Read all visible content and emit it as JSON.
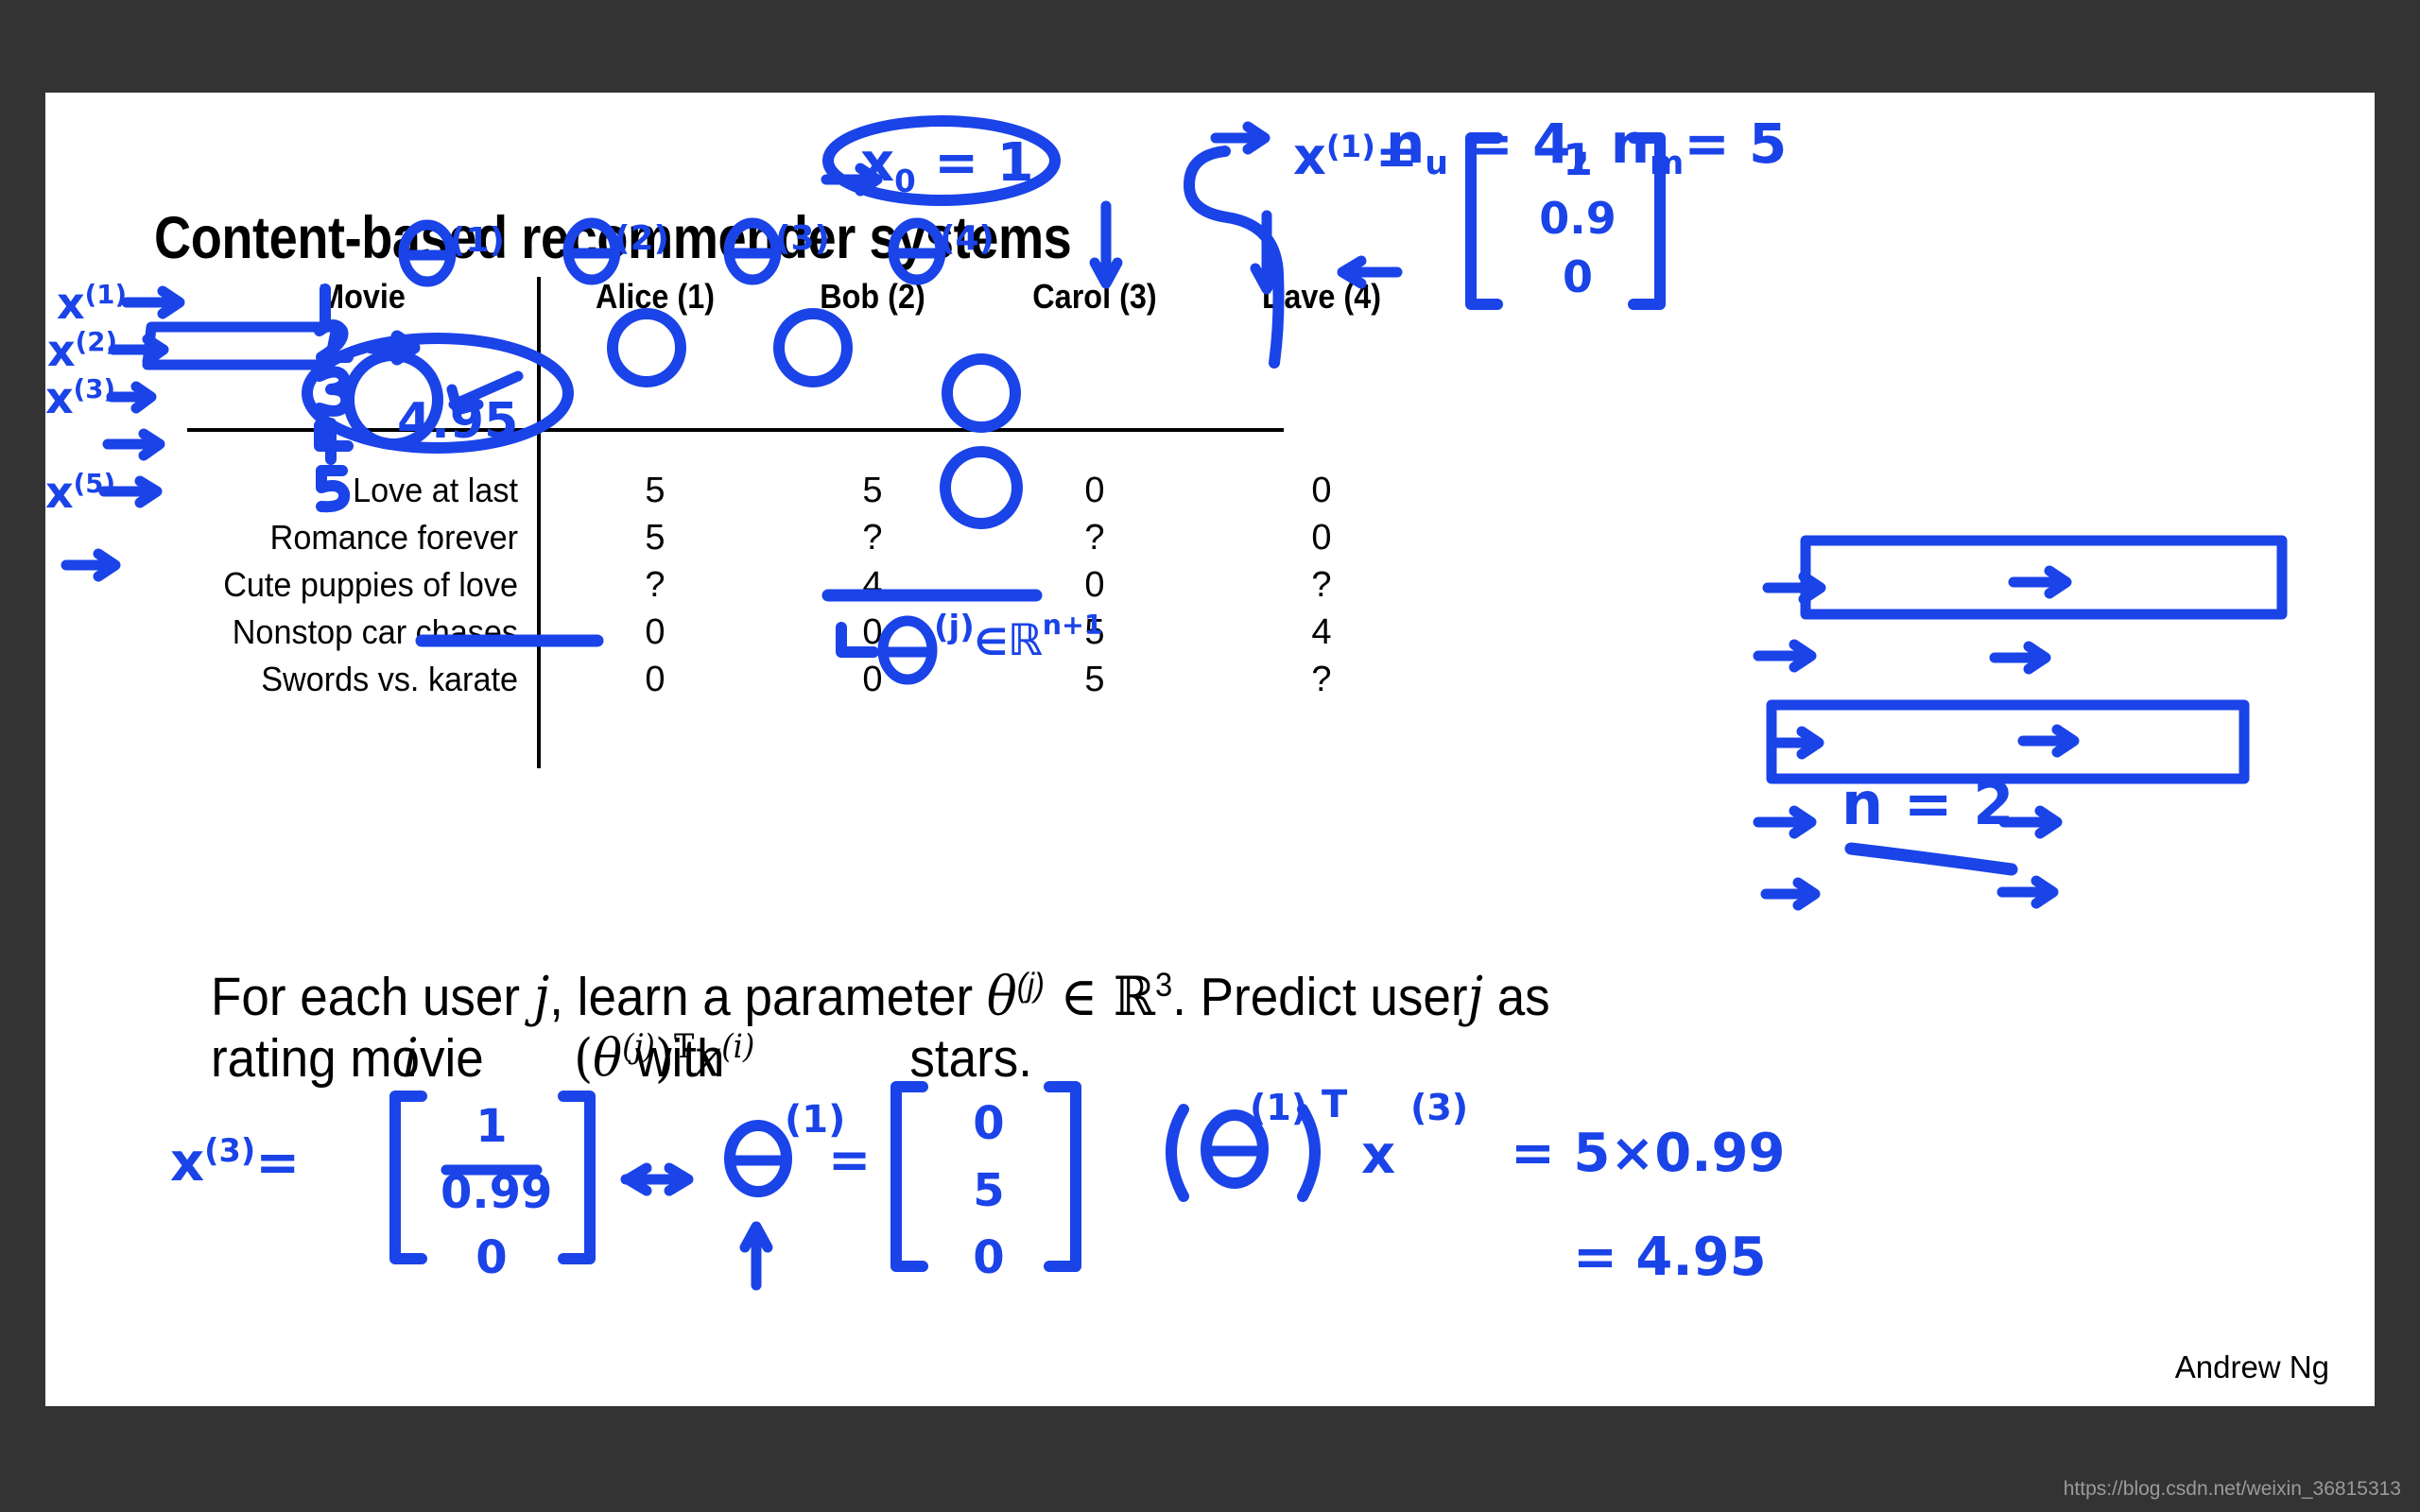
{
  "slide": {
    "title": "Content-based recommender systems",
    "author": "Andrew Ng",
    "watermark": "https://blog.csdn.net/weixin_36815313",
    "ink_color": "#1a43e8",
    "background": "#333333",
    "slide_background": "#ffffff"
  },
  "table": {
    "columns": [
      "Movie",
      "Alice (1)",
      "Bob (2)",
      "Carol (3)",
      "Dave (4)"
    ],
    "rows": [
      {
        "movie": "Love at last",
        "index": "1",
        "ratings": [
          "5",
          "5",
          "0",
          "0"
        ]
      },
      {
        "movie": "Romance forever",
        "index": "2",
        "ratings": [
          "5",
          "?",
          "?",
          "0"
        ]
      },
      {
        "movie": "Cute puppies of love",
        "index": "3",
        "ratings": [
          "?",
          "4",
          "0",
          "?"
        ]
      },
      {
        "movie": "Nonstop car chases",
        "index": "4",
        "ratings": [
          "0",
          "0",
          "5",
          "4"
        ]
      },
      {
        "movie": "Swords vs. karate",
        "index": "5",
        "ratings": [
          "0",
          "0",
          "5",
          "?"
        ]
      }
    ]
  },
  "paragraph": {
    "line1_a": "For each user ",
    "line1_j": "j",
    "line1_b": ", learn a parameter ",
    "line1_theta": "θ",
    "line1_theta_sup": "(j)",
    "line1_in": " ∈ ℝ",
    "line1_dim": "3",
    "line1_c": ". Predict user",
    "line1_j2": "j",
    "line1_d": "  as",
    "line2_a": "rating movie ",
    "line2_i": "i",
    "line2_b": " with",
    "line2_formula_open": "(",
    "line2_formula_theta": "θ",
    "line2_formula_theta_sup": "(j)",
    "line2_formula_close": ")",
    "line2_formula_T": "T",
    "line2_formula_x": "x",
    "line2_formula_x_sup": "(i)",
    "line2_c": "stars."
  },
  "annotations": {
    "n_users": "n",
    "n_users_sub": "u",
    "n_users_eq": "= 4",
    "comma": ",",
    "n_movies": "n",
    "n_movies_sub": "m",
    "n_movies_eq": "= 5",
    "x0": "x",
    "x0_sub": "0",
    "x0_eq": "= 1",
    "x1_label": "x",
    "x1_sup": "(1)",
    "x1_eq": "=",
    "x1_vector": [
      "1",
      "0.9",
      "0"
    ],
    "n_eq_2": "n = 2",
    "theta_headers": [
      {
        "sym": "Θ",
        "sup": "(1)"
      },
      {
        "sym": "Θ",
        "sup": "(2)"
      },
      {
        "sym": "Θ",
        "sup": "(3)"
      },
      {
        "sym": "Θ",
        "sup": "(4)"
      }
    ],
    "x_row_labels": [
      {
        "sym": "x",
        "sup": "(1)"
      },
      {
        "sym": "x",
        "sup": "(2)"
      },
      {
        "sym": "x",
        "sup": "(3)"
      },
      {
        "sym": "x",
        "sup": "(5)"
      }
    ],
    "row_numbers": [
      "1",
      "2",
      "3",
      "4",
      "5"
    ],
    "predicted_value": "4.95",
    "theta_in_R": {
      "sym": "Θ",
      "sup": "(j)",
      "in": "∈",
      "R": "ℝ",
      "dim": "n+1"
    },
    "x3_label": "x",
    "x3_sup": "(3)",
    "x3_eq": "=",
    "x3_vector": [
      "1",
      "0.99",
      "0"
    ],
    "theta1_label": "Θ",
    "theta1_sup": "(1)",
    "theta1_eq": "=",
    "theta1_vector": [
      "0",
      "5",
      "0"
    ],
    "computation_open": "(",
    "computation_theta": "Θ",
    "computation_theta_sup": "(1)",
    "computation_close": ")",
    "computation_T": "T",
    "computation_x": "x",
    "computation_x_sup": "(3)",
    "computation_eq1": "= 5×0.99",
    "computation_eq2": "= 4.95"
  }
}
